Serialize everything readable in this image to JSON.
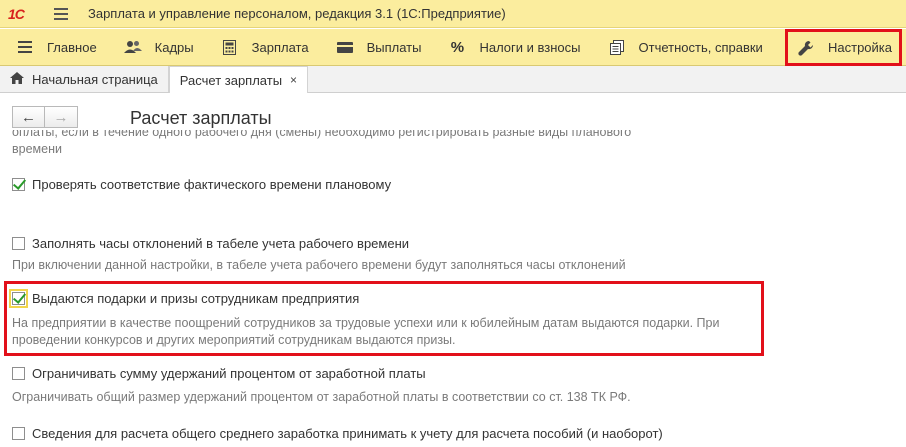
{
  "app": {
    "logo": "1С",
    "title": "Зарплата и управление персоналом, редакция 3.1  (1С:Предприятие)"
  },
  "sections": [
    {
      "label": "Главное",
      "icon": "menu-lines-icon"
    },
    {
      "label": "Кадры",
      "icon": "people-icon"
    },
    {
      "label": "Зарплата",
      "icon": "calculator-icon"
    },
    {
      "label": "Выплаты",
      "icon": "wallet-icon"
    },
    {
      "label": "Налоги и взносы",
      "icon": "percent-icon"
    },
    {
      "label": "Отчетность, справки",
      "icon": "reports-icon"
    },
    {
      "label": "Настройка",
      "icon": "wrench-icon"
    }
  ],
  "tabs": [
    {
      "label": "Начальная страница"
    },
    {
      "label": "Расчет зарплаты",
      "close": "×"
    }
  ],
  "form": {
    "back": "←",
    "forward": "→",
    "title": "Расчет зарплаты"
  },
  "options": {
    "cut_text": "оплаты, если в течение одного рабочего дня (смены) необходимо регистрировать разные виды планового",
    "cut_text_2": "времени",
    "check_time": {
      "label": "Проверять соответствие фактического времени плановому",
      "checked": true
    },
    "fill_hours": {
      "label": "Заполнять часы отклонений в табеле учета рабочего времени",
      "checked": false,
      "desc": "При включении данной настройки, в табеле учета рабочего времени будут заполняться часы отклонений"
    },
    "gifts": {
      "label": "Выдаются подарки и призы сотрудникам предприятия",
      "checked": true,
      "desc_1": "На предприятии в качестве поощрений сотрудников за трудовые успехи или к юбилейным датам выдаются подарки. При",
      "desc_2": "проведении конкурсов и других мероприятий сотрудникам выдаются призы."
    },
    "limit_deductions": {
      "label": "Ограничивать сумму удержаний процентом от заработной платы",
      "checked": false,
      "desc": "Ограничивать общий размер удержаний процентом от заработной платы в соответствии со ст. 138 ТК РФ."
    },
    "avg_earnings": {
      "label": "Сведения для расчета общего среднего заработка принимать к учету для расчета пособий (и наоборот)",
      "checked": false
    }
  },
  "colors": {
    "panel": "#fbed9e",
    "highlight": "#e2101a",
    "check": "#2a9a2a"
  }
}
